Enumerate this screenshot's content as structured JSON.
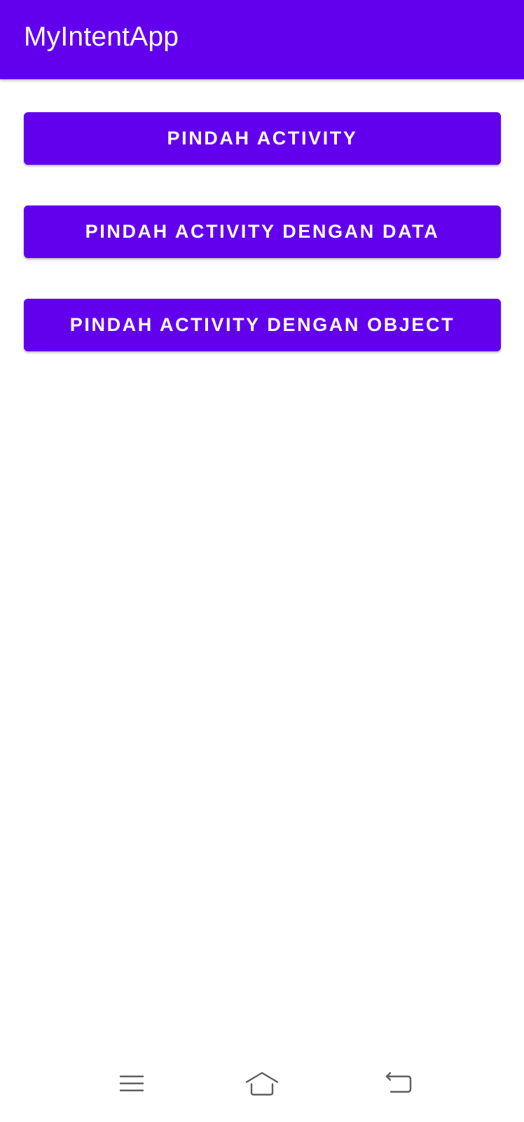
{
  "app_bar": {
    "title": "MyIntentApp",
    "color": "#6200ee"
  },
  "buttons": [
    {
      "label": "PINDAH ACTIVITY"
    },
    {
      "label": "PINDAH ACTIVITY DENGAN DATA"
    },
    {
      "label": "PINDAH ACTIVITY DENGAN OBJECT"
    }
  ],
  "nav_bar": {
    "icons": [
      "menu-icon",
      "home-icon",
      "back-icon"
    ]
  }
}
